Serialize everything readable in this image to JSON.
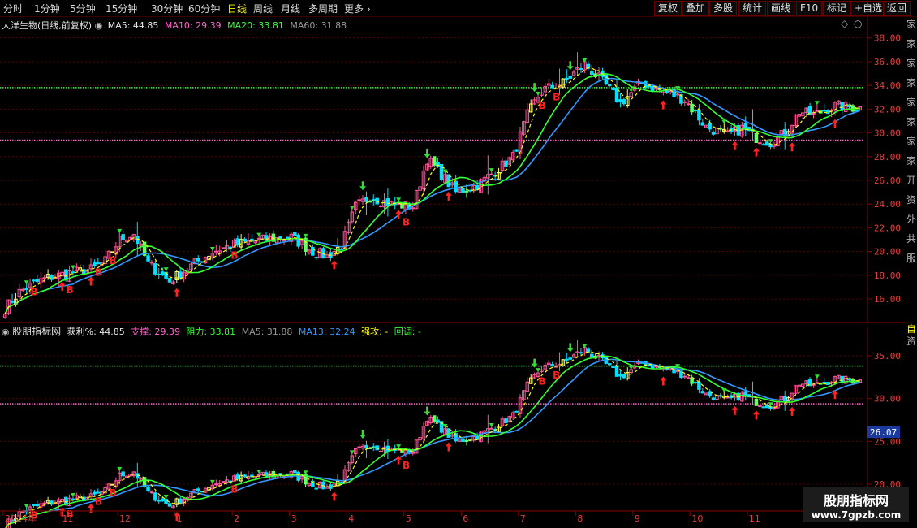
{
  "toolbar": {
    "periods": [
      "分时",
      "1分钟",
      "5分钟",
      "15分钟",
      "30分钟",
      "60分钟",
      "日线",
      "周线",
      "月线",
      "多周期",
      "更多"
    ],
    "active_period": "日线",
    "right_buttons": [
      "复权",
      "叠加",
      "多股",
      "统计",
      "画线",
      "F10",
      "标记",
      "+自选",
      "返回"
    ]
  },
  "upper_header": {
    "title": "大洋生物(日线,前复权)",
    "ma5": "MA5: 44.85",
    "ma10": "MA10: 29.39",
    "ma20": "MA20: 33.81",
    "ma60": "MA60: 31.88"
  },
  "lower_header": {
    "title": "股朋指标网",
    "profit": "获利%: 44.85",
    "support": "支撑: 29.39",
    "resistance": "阻力: 33.81",
    "ma5": "MA5: 31.88",
    "ma13": "MA13: 32.24",
    "strong": "强攻: -",
    "pullback": "回调: -"
  },
  "side_text": {
    "upper": [
      "家",
      "家",
      "家",
      "家",
      "家",
      "家",
      "家",
      "家",
      "开",
      "资",
      "外",
      "共",
      "服"
    ],
    "lower": [
      "自",
      "资"
    ]
  },
  "watermark": {
    "line1": "股朋指标网",
    "line2": "www.7gpzb.com"
  },
  "colors": {
    "up": "#ff5599",
    "down": "#00e0ff",
    "up_alt": "#ffff66",
    "down_alt": "#66ff66",
    "resistance": "#33ff33",
    "support": "#ff66cc",
    "ma_fast": "#ffff00",
    "ma_slow": "#3399ff",
    "ma_mid": "#33ff33",
    "buy_signal": "#ff2222",
    "sell_signal": "#33dd33",
    "grid": "#5a0000"
  },
  "chart_data": [
    {
      "type": "candlestick",
      "panel": "upper",
      "title": "大洋生物(日线,前复权)",
      "ylim": [
        14.5,
        38.8
      ],
      "y_ticks": [
        16.0,
        18.0,
        20.0,
        22.0,
        24.0,
        26.0,
        28.0,
        30.0,
        32.0,
        34.0,
        36.0,
        38.0
      ],
      "x_ticks": [
        "2024年",
        "11",
        "12",
        "1",
        "2",
        "3",
        "4",
        "5",
        "6",
        "7",
        "8",
        "9",
        "10",
        "11",
        "12"
      ],
      "x_tick_index": [
        0,
        14,
        28,
        42,
        56,
        70,
        84,
        98,
        112,
        126,
        140,
        154,
        168,
        182,
        196
      ],
      "n_bars": 240,
      "resistance_level": 33.81,
      "support_level": 29.39,
      "anchors": [
        [
          0,
          15.2
        ],
        [
          4,
          16.6
        ],
        [
          8,
          17.3
        ],
        [
          12,
          17.8
        ],
        [
          18,
          18.2
        ],
        [
          24,
          18.5
        ],
        [
          28,
          19.2
        ],
        [
          32,
          21.0
        ],
        [
          36,
          21.5
        ],
        [
          40,
          19.0
        ],
        [
          46,
          17.5
        ],
        [
          52,
          18.8
        ],
        [
          58,
          20.0
        ],
        [
          64,
          20.6
        ],
        [
          72,
          21.0
        ],
        [
          80,
          21.2
        ],
        [
          86,
          20.0
        ],
        [
          90,
          19.6
        ],
        [
          94,
          20.5
        ],
        [
          98,
          23.8
        ],
        [
          102,
          24.6
        ],
        [
          108,
          24.0
        ],
        [
          114,
          23.8
        ],
        [
          118,
          27.8
        ],
        [
          122,
          26.5
        ],
        [
          126,
          25.0
        ],
        [
          132,
          25.6
        ],
        [
          138,
          27.0
        ],
        [
          142,
          28.0
        ],
        [
          146,
          31.5
        ],
        [
          150,
          33.6
        ],
        [
          156,
          34.2
        ],
        [
          162,
          35.8
        ],
        [
          168,
          34.0
        ],
        [
          172,
          32.5
        ],
        [
          178,
          34.2
        ],
        [
          184,
          33.5
        ],
        [
          190,
          32.8
        ],
        [
          196,
          30.5
        ],
        [
          202,
          29.8
        ],
        [
          206,
          30.4
        ],
        [
          210,
          29.6
        ],
        [
          214,
          29.2
        ],
        [
          218,
          30.0
        ],
        [
          222,
          31.8
        ],
        [
          226,
          31.5
        ],
        [
          232,
          32.3
        ],
        [
          239,
          32.1
        ]
      ],
      "buy_markers": [
        [
          8,
          "B"
        ],
        [
          18,
          "B"
        ],
        [
          26,
          "B"
        ],
        [
          30,
          "B"
        ],
        [
          64,
          "B"
        ],
        [
          154,
          "B"
        ],
        [
          150,
          "B"
        ],
        [
          112,
          "B"
        ]
      ],
      "up_arrows": [
        16,
        24,
        48,
        92,
        110,
        124,
        184,
        204,
        210,
        220,
        232
      ],
      "down_arrows": [
        100,
        118,
        148,
        158
      ]
    },
    {
      "type": "candlestick",
      "panel": "lower",
      "title": "股朋指标网",
      "ylim": [
        18.2,
        37.0
      ],
      "y_ticks": [
        20.0,
        25.0,
        30.0,
        35.0
      ],
      "current_price_label": "26.07",
      "resistance_level": 33.81,
      "support_level": 29.39
    }
  ]
}
